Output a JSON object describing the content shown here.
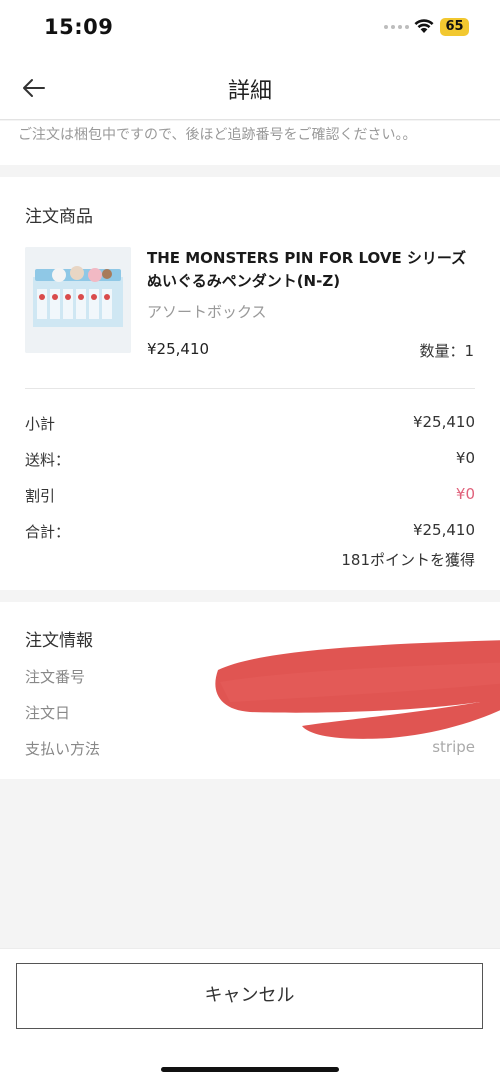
{
  "status_bar": {
    "time": "15:09",
    "battery": "65"
  },
  "header": {
    "title": "詳細"
  },
  "notice": "ご注文は梱包中ですので、後ほど追跡番号をご確認ください。。",
  "products_section": {
    "title": "注文商品",
    "item": {
      "name": "THE MONSTERS PIN FOR LOVE シリーズぬいぐるみペンダント(N-Z)",
      "variant": "アソートボックス",
      "price": "¥25,410",
      "quantity": "数量：1"
    }
  },
  "summary": {
    "subtotal_label": "小計",
    "subtotal_value": "¥25,410",
    "shipping_label": "送料：",
    "shipping_value": "¥0",
    "discount_label": "割引",
    "discount_value": "¥0",
    "total_label": "合計：",
    "total_value": "¥25,410",
    "points": "181ポイントを獲得"
  },
  "order_info": {
    "title": "注文情報",
    "order_number_label": "注文番号",
    "order_date_label": "注文日",
    "payment_label": "支払い方法",
    "payment_value": "stripe"
  },
  "actions": {
    "cancel_label": "キャンセル"
  },
  "colors": {
    "discount_red": "#e0607a",
    "battery_yellow": "#f2c830",
    "redaction_red": "#e05552"
  }
}
